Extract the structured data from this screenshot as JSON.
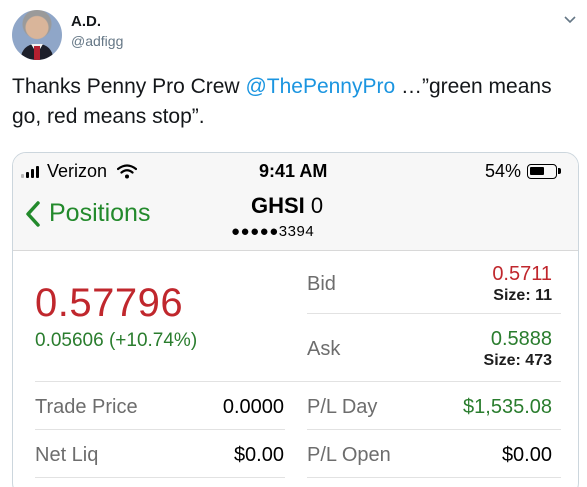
{
  "tweet": {
    "name": "A.D.",
    "handle": "@adfigg",
    "text_before": "Thanks Penny Pro Crew ",
    "mention": "@ThePennyPro",
    "text_after": " …”green means go, red means stop”."
  },
  "phone": {
    "carrier": "Verizon",
    "time": "9:41 AM",
    "battery": "54%",
    "back_label": "Positions",
    "symbol": "GHSI",
    "symbol_qty": "0",
    "account": "●●●●●3394"
  },
  "quote": {
    "last_price": "0.57796",
    "change": "0.05606 (+10.74%)",
    "bid_label": "Bid",
    "bid": "0.5711",
    "bid_size": "Size: 11",
    "ask_label": "Ask",
    "ask": "0.5888",
    "ask_size": "Size: 473",
    "trade_price_label": "Trade Price",
    "trade_price": "0.0000",
    "pl_day_label": "P/L Day",
    "pl_day": "$1,535.08",
    "net_liq_label": "Net Liq",
    "net_liq": "$0.00",
    "pl_open_label": "P/L Open",
    "pl_open": "$0.00"
  },
  "colors": {
    "mention": "#1b95e0",
    "down_red": "#c0272d",
    "up_green": "#2a7d2e",
    "nav_green": "#238a2c"
  },
  "icons": [
    "chevron-down-icon",
    "signal-icon",
    "wifi-icon",
    "battery-icon",
    "back-chevron-icon"
  ]
}
